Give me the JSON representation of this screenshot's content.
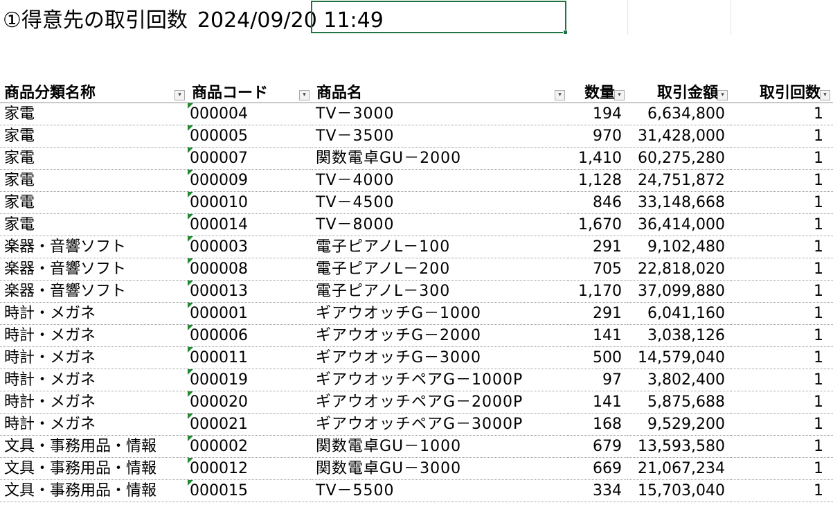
{
  "sheet": {
    "title": "①得意先の取引回数",
    "timestamp": "2024/09/20  11:49"
  },
  "table": {
    "headers": {
      "category": "商品分類名称",
      "code": "商品コード",
      "name": "商品名",
      "quantity": "数量",
      "amount": "取引金額",
      "count": "取引回数"
    },
    "rows": [
      {
        "category": "家電",
        "code": "000004",
        "name": "TV－3000",
        "quantity": "194",
        "amount": "6,634,800",
        "count": "1"
      },
      {
        "category": "家電",
        "code": "000005",
        "name": "TV－3500",
        "quantity": "970",
        "amount": "31,428,000",
        "count": "1"
      },
      {
        "category": "家電",
        "code": "000007",
        "name": "関数電卓GU－2000",
        "quantity": "1,410",
        "amount": "60,275,280",
        "count": "1"
      },
      {
        "category": "家電",
        "code": "000009",
        "name": "TV－4000",
        "quantity": "1,128",
        "amount": "24,751,872",
        "count": "1"
      },
      {
        "category": "家電",
        "code": "000010",
        "name": "TV－4500",
        "quantity": "846",
        "amount": "33,148,668",
        "count": "1"
      },
      {
        "category": "家電",
        "code": "000014",
        "name": "TV－8000",
        "quantity": "1,670",
        "amount": "36,414,000",
        "count": "1"
      },
      {
        "category": "楽器・音響ソフト",
        "code": "000003",
        "name": "電子ピアノL－100",
        "quantity": "291",
        "amount": "9,102,480",
        "count": "1"
      },
      {
        "category": "楽器・音響ソフト",
        "code": "000008",
        "name": "電子ピアノL－200",
        "quantity": "705",
        "amount": "22,818,020",
        "count": "1"
      },
      {
        "category": "楽器・音響ソフト",
        "code": "000013",
        "name": "電子ピアノL－300",
        "quantity": "1,170",
        "amount": "37,099,880",
        "count": "1"
      },
      {
        "category": "時計・メガネ",
        "code": "000001",
        "name": "ギアウオッチG－1000",
        "quantity": "291",
        "amount": "6,041,160",
        "count": "1"
      },
      {
        "category": "時計・メガネ",
        "code": "000006",
        "name": "ギアウオッチG－2000",
        "quantity": "141",
        "amount": "3,038,126",
        "count": "1"
      },
      {
        "category": "時計・メガネ",
        "code": "000011",
        "name": "ギアウオッチG－3000",
        "quantity": "500",
        "amount": "14,579,040",
        "count": "1"
      },
      {
        "category": "時計・メガネ",
        "code": "000019",
        "name": "ギアウオッチペアG－1000P",
        "quantity": "97",
        "amount": "3,802,400",
        "count": "1"
      },
      {
        "category": "時計・メガネ",
        "code": "000020",
        "name": "ギアウオッチペアG－2000P",
        "quantity": "141",
        "amount": "5,875,688",
        "count": "1"
      },
      {
        "category": "時計・メガネ",
        "code": "000021",
        "name": "ギアウオッチペアG－3000P",
        "quantity": "168",
        "amount": "9,529,200",
        "count": "1"
      },
      {
        "category": "文具・事務用品・情報",
        "code": "000002",
        "name": "関数電卓GU－1000",
        "quantity": "679",
        "amount": "13,593,580",
        "count": "1"
      },
      {
        "category": "文具・事務用品・情報",
        "code": "000012",
        "name": "関数電卓GU－3000",
        "quantity": "669",
        "amount": "21,067,234",
        "count": "1"
      },
      {
        "category": "文具・事務用品・情報",
        "code": "000015",
        "name": "TV－5500",
        "quantity": "334",
        "amount": "15,703,040",
        "count": "1"
      }
    ]
  },
  "colors": {
    "selection_border": "#217346",
    "error_indicator": "#1e8a2e"
  },
  "icons": {
    "filter": "filter-dropdown-icon",
    "number_as_text": "number-stored-as-text-indicator"
  }
}
